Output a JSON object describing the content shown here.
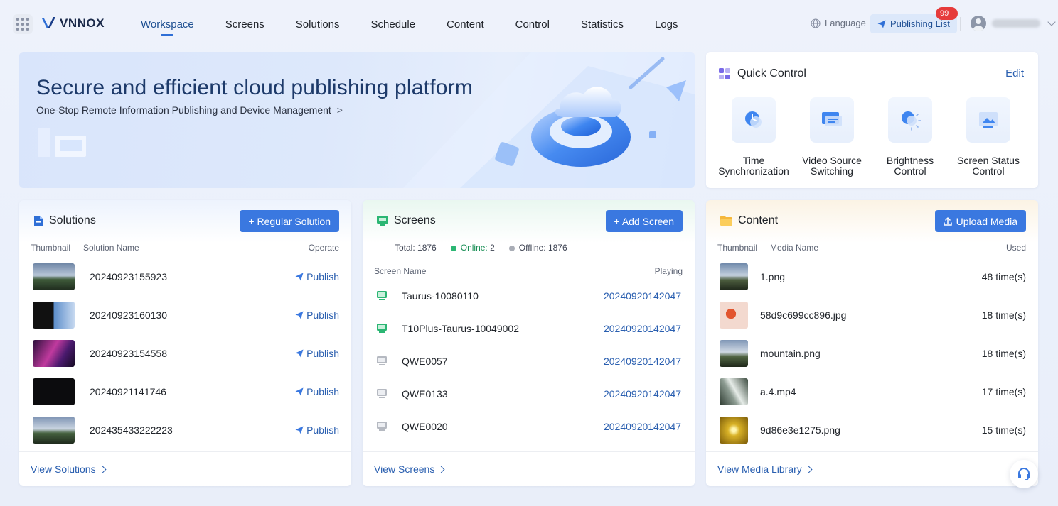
{
  "brand": {
    "name": "VNNOX"
  },
  "nav": {
    "items": [
      {
        "label": "Workspace",
        "active": true
      },
      {
        "label": "Screens"
      },
      {
        "label": "Solutions"
      },
      {
        "label": "Schedule"
      },
      {
        "label": "Content"
      },
      {
        "label": "Control"
      },
      {
        "label": "Statistics"
      },
      {
        "label": "Logs"
      }
    ]
  },
  "header": {
    "language_label": "Language",
    "publishing_list_label": "Publishing List",
    "publishing_badge": "99+"
  },
  "hero": {
    "title": "Secure and efficient cloud publishing platform",
    "subtitle": "One-Stop Remote Information Publishing and Device Management",
    "subtitle_arrow": ">"
  },
  "quick_control": {
    "title": "Quick Control",
    "edit_label": "Edit",
    "items": [
      {
        "label": "Time\nSynchronization",
        "icon": "clock-sync-icon"
      },
      {
        "label": "Video Source\nSwitching",
        "icon": "video-source-icon"
      },
      {
        "label": "Brightness\nControl",
        "icon": "brightness-icon"
      },
      {
        "label": "Screen Status\nControl",
        "icon": "screen-status-icon"
      }
    ]
  },
  "solutions": {
    "title": "Solutions",
    "button_label": "+ Regular Solution",
    "col_thumbnail": "Thumbnail",
    "col_name": "Solution Name",
    "col_operate": "Operate",
    "publish_label": "Publish",
    "rows": [
      {
        "name": "20240923155923"
      },
      {
        "name": "20240923160130"
      },
      {
        "name": "20240923154558"
      },
      {
        "name": "20240921141746"
      },
      {
        "name": "202435433222223"
      }
    ],
    "footer_link": "View Solutions"
  },
  "screens": {
    "title": "Screens",
    "button_label": "+ Add Screen",
    "total_label": "Total:",
    "total_value": "1876",
    "online_label": "Online:",
    "online_value": "2",
    "offline_label": "Offline:",
    "offline_value": "1876",
    "col_name": "Screen Name",
    "col_playing": "Playing",
    "rows": [
      {
        "name": "Taurus-10080110",
        "playing": "20240920142047",
        "status": "online"
      },
      {
        "name": "T10Plus-Taurus-10049002",
        "playing": "20240920142047",
        "status": "online"
      },
      {
        "name": "QWE0057",
        "playing": "20240920142047",
        "status": "offline"
      },
      {
        "name": "QWE0133",
        "playing": "20240920142047",
        "status": "offline"
      },
      {
        "name": "QWE0020",
        "playing": "20240920142047",
        "status": "offline"
      }
    ],
    "footer_link": "View Screens",
    "colors": {
      "online": "#2bb673",
      "offline": "#a9adb6"
    }
  },
  "content": {
    "title": "Content",
    "button_label": "Upload Media",
    "col_thumbnail": "Thumbnail",
    "col_name": "Media Name",
    "col_used": "Used",
    "rows": [
      {
        "name": "1.png",
        "used": "48 time(s)"
      },
      {
        "name": "58d9c699cc896.jpg",
        "used": "18 time(s)"
      },
      {
        "name": "mountain.png",
        "used": "18 time(s)"
      },
      {
        "name": "a.4.mp4",
        "used": "17 time(s)"
      },
      {
        "name": "9d86e3e1275.png",
        "used": "15 time(s)"
      }
    ],
    "footer_link": "View Media Library"
  },
  "colors": {
    "accent": "#3a78e0",
    "link": "#2a5fb0",
    "badge": "#e63b3b"
  }
}
